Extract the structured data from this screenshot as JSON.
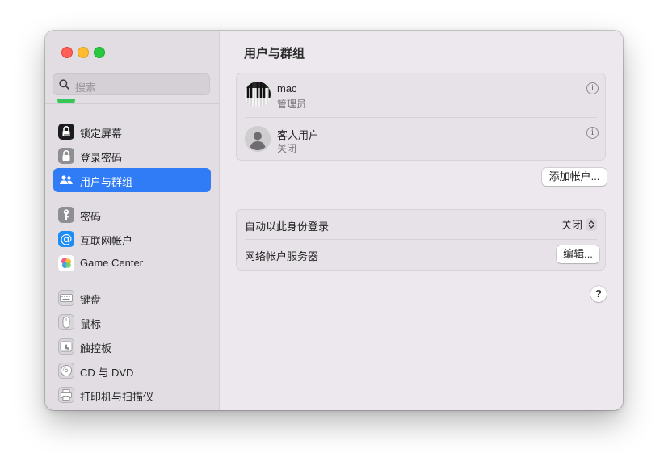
{
  "window": {
    "title": "用户与群组"
  },
  "sidebar": {
    "search_placeholder": "搜索",
    "items": [
      {
        "label": "锁定屏幕",
        "icon": "lock-screen-icon"
      },
      {
        "label": "登录密码",
        "icon": "login-password-icon"
      },
      {
        "label": "用户与群组",
        "icon": "users-groups-icon",
        "selected": true
      },
      {
        "label": "密码",
        "icon": "key-icon"
      },
      {
        "label": "互联网帐户",
        "icon": "at-sign-icon"
      },
      {
        "label": "Game Center",
        "icon": "game-center-icon"
      },
      {
        "label": "键盘",
        "icon": "keyboard-icon"
      },
      {
        "label": "鼠标",
        "icon": "mouse-icon"
      },
      {
        "label": "触控板",
        "icon": "trackpad-icon"
      },
      {
        "label": "CD 与 DVD",
        "icon": "cd-dvd-icon"
      },
      {
        "label": "打印机与扫描仪",
        "icon": "printer-icon"
      }
    ]
  },
  "users": [
    {
      "name": "mac",
      "role": "管理员",
      "avatar": "piano-keys-avatar"
    },
    {
      "name": "客人用户",
      "role": "关闭",
      "avatar": "generic-person-avatar"
    }
  ],
  "add_account_label": "添加帐户...",
  "settings": {
    "auto_login": {
      "label": "自动以此身份登录",
      "value": "关闭"
    },
    "network_server": {
      "label": "网络帐户服务器",
      "button": "编辑..."
    }
  },
  "help_label": "?",
  "colors": {
    "accent": "#2f7cf6",
    "sidebar_bg": "#e1dde3",
    "content_bg": "#ece8ed"
  }
}
